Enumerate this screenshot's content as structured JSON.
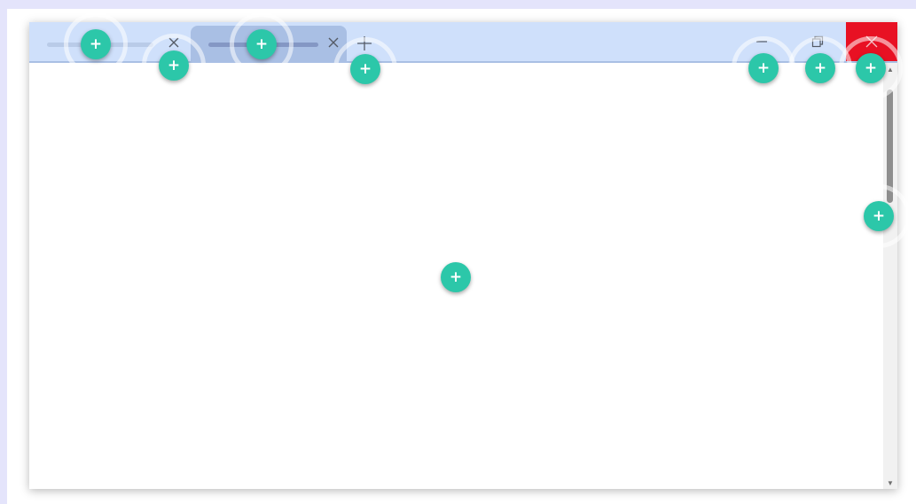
{
  "colors": {
    "frame": "#e4e4fb",
    "titlebar": "#cfe0fb",
    "active_tab": "#a9bfe4",
    "inactive_tab_title": "#b9cbe8",
    "active_tab_title": "#8497c4",
    "icon": "#555b66",
    "close_button": "#e81123",
    "close_glyph": "#f3c0c5",
    "scrollbar_track": "#f1f1f1",
    "scrollbar_thumb": "#8e8e8e",
    "scrollbar_arrow": "#6f6f6f",
    "marker": "#2cc7a9"
  },
  "tabs": [
    {
      "title": "",
      "active": false,
      "close_icon": "close-icon"
    },
    {
      "title": "",
      "active": true,
      "close_icon": "close-icon"
    }
  ],
  "titlebar": {
    "new_tab_icon": "plus-icon",
    "minimize_icon": "minimize-icon",
    "maximize_icon": "restore-icon",
    "close_icon": "close-icon"
  },
  "scrollbar": {
    "up_arrow": "▲",
    "down_arrow": "▼"
  },
  "markers": {
    "symbol": "+",
    "icon": "plus-circle-icon",
    "count": 9
  }
}
